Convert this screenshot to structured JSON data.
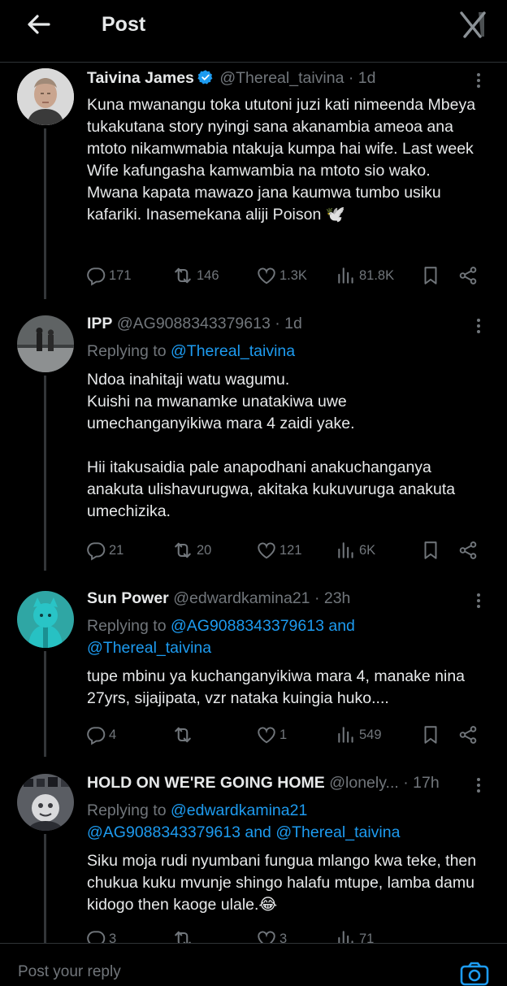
{
  "header": {
    "title": "Post"
  },
  "colors": {
    "background": "#000000",
    "text": "#e7e9ea",
    "muted": "#71767b",
    "link": "#1d9bf0",
    "verified": "#1d9bf0"
  },
  "posts": [
    {
      "name": "Taivina James",
      "verified": true,
      "handle": "@Thereal_taivina",
      "dot": "·",
      "time": "1d",
      "text": "Kuna mwanangu toka ututoni juzi kati nimeenda Mbeya tukakutana story nyingi sana akanambia ameoa ana mtoto nikamwmabia ntakuja kumpa hai wife. Last week Wife kafungasha kamwambia na mtoto sio wako. Mwana kapata mawazo jana kaumwa tumbo usiku kafariki. Inasemekana aliji Poison 🕊️",
      "replies": "171",
      "reposts": "146",
      "likes": "1.3K",
      "views": "81.8K"
    },
    {
      "name": "IPP",
      "handle": "@AG9088343379613",
      "dot": "·",
      "time": "1d",
      "replying_label": "Replying to",
      "replying_line1": "@Thereal_taivina",
      "text": "Ndoa inahitaji watu wagumu.\nKuishi na mwanamke unatakiwa uwe umechanganyikiwa mara 4 zaidi yake.\n\nHii itakusaidia pale anapodhani anakuchanganya anakuta ulishavurugwa, akitaka kukuvuruga anakuta umechizika.",
      "replies": "21",
      "reposts": "20",
      "likes": "121",
      "views": "6K"
    },
    {
      "name": "Sun Power",
      "handle": "@edwardkamina21",
      "dot": "·",
      "time": "23h",
      "replying_label": "Replying to",
      "replying_line1": "@AG9088343379613 and",
      "replying_line2": "@Thereal_taivina",
      "text": "tupe mbinu ya kuchanganyikiwa mara 4, manake nina 27yrs, sijajipata, vzr nataka kuingia huko....",
      "replies": "4",
      "reposts": "",
      "likes": "1",
      "views": "549"
    },
    {
      "name": "HOLD ON WE'RE GOING HOME",
      "handle": "@lonely...",
      "dot": "·",
      "time": "17h",
      "replying_label": "Replying to",
      "replying_line1": "@edwardkamina21",
      "replying_line2": "@AG9088343379613 and @Thereal_taivina",
      "text": "Siku moja rudi nyumbani fungua mlango kwa teke, then chukua kuku mvunje shingo halafu mtupe, lamba damu kidogo then kaoge ulale.😂",
      "replies": "3",
      "reposts": "",
      "likes": "3",
      "views": "71"
    }
  ],
  "composer": {
    "placeholder": "Post your reply"
  }
}
